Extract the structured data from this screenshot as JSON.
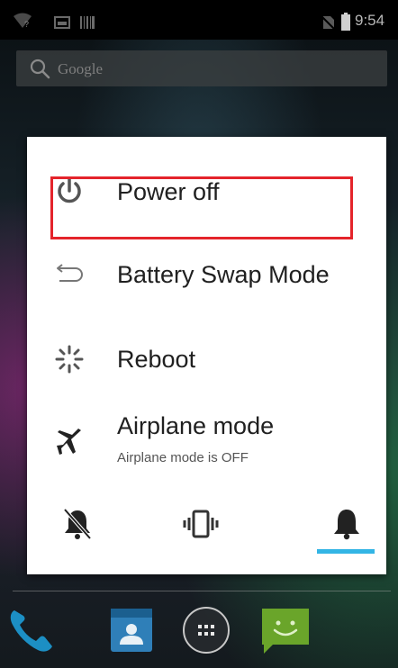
{
  "status_bar": {
    "time": "9:54",
    "icons": [
      "wifi-question-icon",
      "picture-icon",
      "barcode-icon",
      "no-sim-icon",
      "battery-icon"
    ]
  },
  "search": {
    "placeholder": "Google",
    "icon": "search-icon"
  },
  "power_menu": {
    "items": [
      {
        "label": "Power off",
        "icon": "power-icon"
      },
      {
        "label": "Battery Swap Mode",
        "icon": "battery-swap-icon"
      },
      {
        "label": "Reboot",
        "icon": "reboot-icon"
      },
      {
        "label": "Airplane mode",
        "sublabel": "Airplane mode is OFF",
        "icon": "airplane-icon"
      }
    ],
    "sound_modes": [
      {
        "icon": "silent-bell-icon",
        "selected": false
      },
      {
        "icon": "vibrate-icon",
        "selected": false
      },
      {
        "icon": "bell-icon",
        "selected": true
      }
    ],
    "highlight_color": "#e4242b",
    "selected_color": "#33b5e5"
  },
  "dock": {
    "apps": [
      {
        "icon": "phone-icon"
      },
      {
        "icon": "contacts-icon"
      },
      {
        "icon": "app-drawer-icon"
      },
      {
        "icon": "messaging-icon"
      }
    ]
  }
}
